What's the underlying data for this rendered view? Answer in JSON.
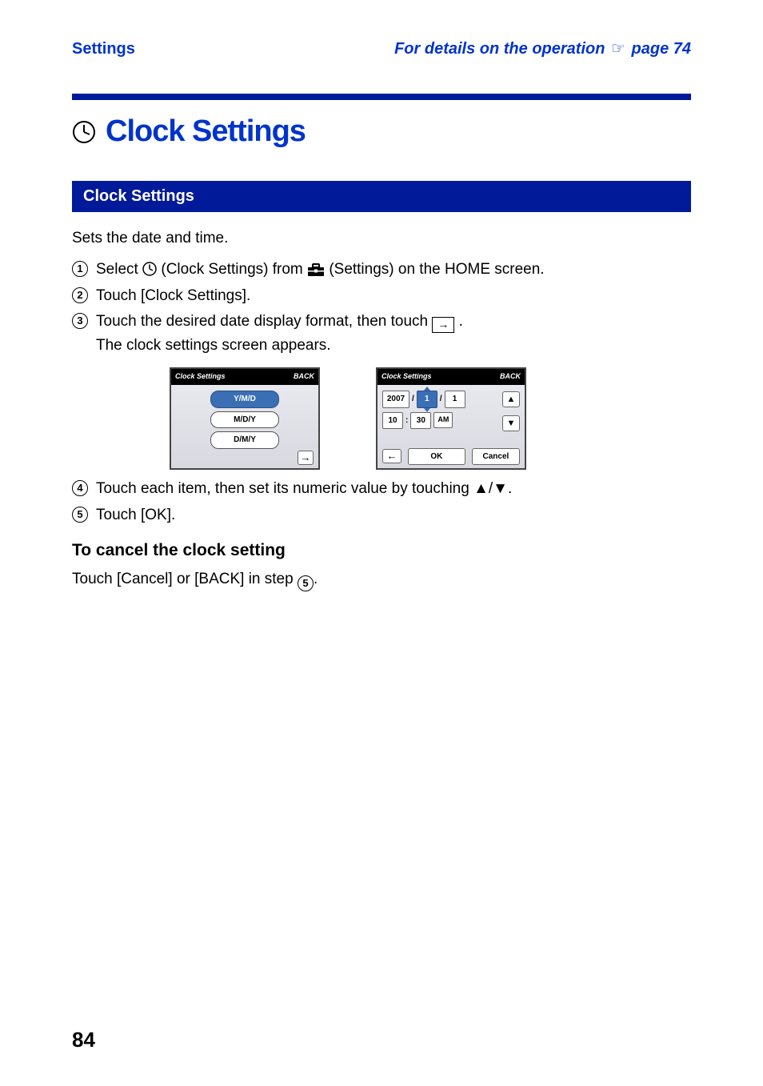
{
  "header": {
    "section": "Settings",
    "details_prefix": "For details on the operation",
    "details_page_ref": "page 74"
  },
  "title": "Clock Settings",
  "bluebar": "Clock Settings",
  "intro": "Sets the date and time.",
  "steps": {
    "s1_a": "Select ",
    "s1_b": " (Clock Settings) from ",
    "s1_c": " (Settings) on the HOME screen.",
    "s2": "Touch [Clock Settings].",
    "s3_a": "Touch the desired date display format, then touch ",
    "s3_b": ".",
    "s3_line2": "The clock settings screen appears.",
    "s4": "Touch each item, then set its numeric value by touching ▲/▼.",
    "s5": "Touch [OK]."
  },
  "screen1": {
    "title": "Clock Settings",
    "back": "BACK",
    "opt1": "Y/M/D",
    "opt2": "M/D/Y",
    "opt3": "D/M/Y"
  },
  "screen2": {
    "title": "Clock Settings",
    "back": "BACK",
    "year": "2007",
    "month": "1",
    "day": "1",
    "hour": "10",
    "minute": "30",
    "ampm": "AM",
    "ok": "OK",
    "cancel": "Cancel"
  },
  "cancel_heading": "To cancel the clock setting",
  "cancel_body_a": "Touch [Cancel] or [BACK] in step ",
  "cancel_body_num": "5",
  "cancel_body_b": ".",
  "page_number": "84"
}
